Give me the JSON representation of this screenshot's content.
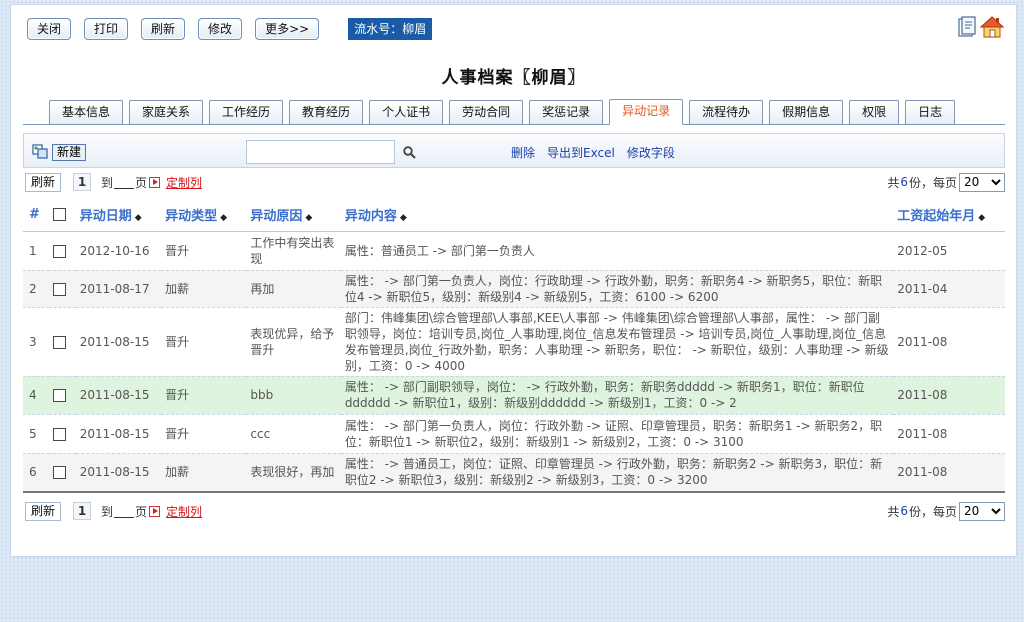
{
  "toolbar": {
    "buttons": [
      "关闭",
      "打印",
      "刷新",
      "修改",
      "更多>>"
    ],
    "serial_label": "流水号：柳眉"
  },
  "icons": {
    "top": [
      "document-icon",
      "home-icon"
    ],
    "new": "new-record-icon",
    "search": "search-icon"
  },
  "title": "人事档案〖柳眉〗",
  "tabs": {
    "items": [
      "基本信息",
      "家庭关系",
      "工作经历",
      "教育经历",
      "个人证书",
      "劳动合同",
      "奖惩记录",
      "异动记录",
      "流程待办",
      "假期信息",
      "权限",
      "日志"
    ],
    "active": "异动记录"
  },
  "actions": {
    "new_label": "新建",
    "search_value": "",
    "links": [
      "删除",
      "导出到Excel",
      "修改字段"
    ]
  },
  "pager": {
    "refresh": "刷新",
    "current_page": "1",
    "to": "到",
    "page_unit": "页",
    "custom": "定制列",
    "total_prefix": "共",
    "total_count": "6",
    "total_suffix": "份，",
    "per_page_label": "每页",
    "per_page": "20"
  },
  "table": {
    "columns": [
      "#",
      "",
      "异动日期",
      "异动类型",
      "异动原因",
      "异动内容",
      "工资起始年月"
    ],
    "rows": [
      {
        "num": "1",
        "date": "2012-10-16",
        "type": "晋升",
        "reason": "工作中有突出表现",
        "content": "属性：普通员工 -> 部门第一负责人",
        "month": "2012-05"
      },
      {
        "num": "2",
        "date": "2011-08-17",
        "type": "加薪",
        "reason": "再加",
        "content": "属性： -> 部门第一负责人，岗位：行政助理 -> 行政外勤，职务：新职务4 -> 新职务5，职位：新职位4 -> 新职位5，级别：新级别4 -> 新级别5，工资：6100 -> 6200",
        "month": "2011-04"
      },
      {
        "num": "3",
        "date": "2011-08-15",
        "type": "晋升",
        "reason": "表现优异，给予晋升",
        "content": "部门：伟峰集团\\综合管理部\\人事部,KEE\\人事部 -> 伟峰集团\\综合管理部\\人事部，属性： -> 部门副职领导，岗位：培训专员,岗位_人事助理,岗位_信息发布管理员 -> 培训专员,岗位_人事助理,岗位_信息发布管理员,岗位_行政外勤，职务：人事助理 -> 新职务，职位： -> 新职位，级别：人事助理 -> 新级别，工资：0 -> 4000",
        "month": "2011-08"
      },
      {
        "num": "4",
        "date": "2011-08-15",
        "type": "晋升",
        "reason": "bbb",
        "content": "属性： -> 部门副职领导，岗位： -> 行政外勤，职务：新职务ddddd -> 新职务1，职位：新职位dddddd -> 新职位1，级别：新级别dddddd -> 新级别1，工资：0 -> 2",
        "month": "2011-08"
      },
      {
        "num": "5",
        "date": "2011-08-15",
        "type": "晋升",
        "reason": "ccc",
        "content": "属性： -> 部门第一负责人，岗位：行政外勤 -> 证照、印章管理员，职务：新职务1 -> 新职务2，职位：新职位1 -> 新职位2，级别：新级别1 -> 新级别2，工资：0 -> 3100",
        "month": "2011-08"
      },
      {
        "num": "6",
        "date": "2011-08-15",
        "type": "加薪",
        "reason": "表现很好，再加",
        "content": "属性： -> 普通员工，岗位：证照、印章管理员 -> 行政外勤，职务：新职务2 -> 新职务3，职位：新职位2 -> 新职位3，级别：新级别2 -> 新级别3，工资：0 -> 3200",
        "month": "2011-08"
      }
    ]
  }
}
